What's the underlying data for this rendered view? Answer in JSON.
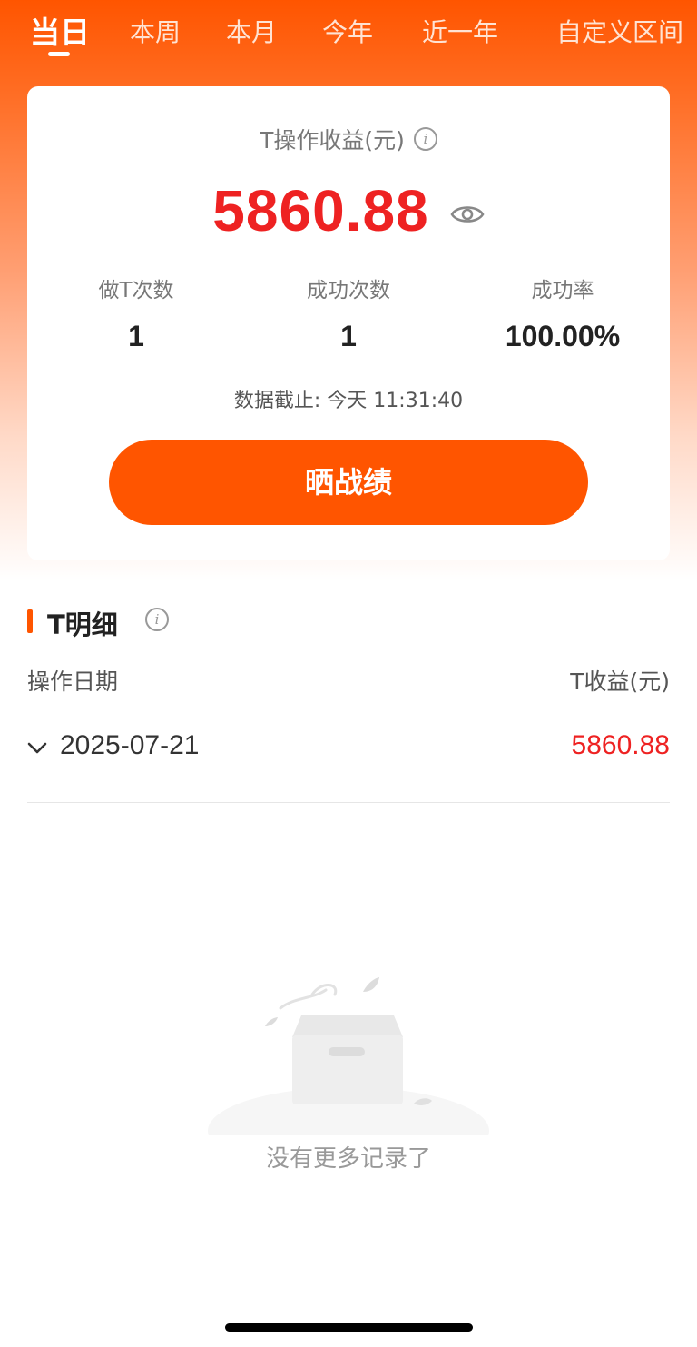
{
  "tabs": {
    "items": [
      "当日",
      "本周",
      "本月",
      "今年",
      "近一年",
      "自定义区间"
    ],
    "active_index": 0
  },
  "summary": {
    "title": "T操作收益(元)",
    "amount": "5860.88",
    "stats": [
      {
        "label": "做T次数",
        "value": "1"
      },
      {
        "label": "成功次数",
        "value": "1"
      },
      {
        "label": "成功率",
        "value": "100.00%"
      }
    ],
    "update_time": "数据截止: 今天 11:31:40",
    "share_button": "晒战绩"
  },
  "detail": {
    "title": "T明细",
    "col_date": "操作日期",
    "col_profit": "T收益(元)",
    "rows": [
      {
        "date": "2025-07-21",
        "profit": "5860.88"
      }
    ],
    "empty_text": "没有更多记录了"
  },
  "colors": {
    "accent": "#ff5500",
    "profit_red": "#ee2222"
  },
  "icons": {
    "info": "info-icon",
    "eye": "eye-icon",
    "expand": "chevron-down-icon",
    "empty": "empty-box-icon"
  }
}
